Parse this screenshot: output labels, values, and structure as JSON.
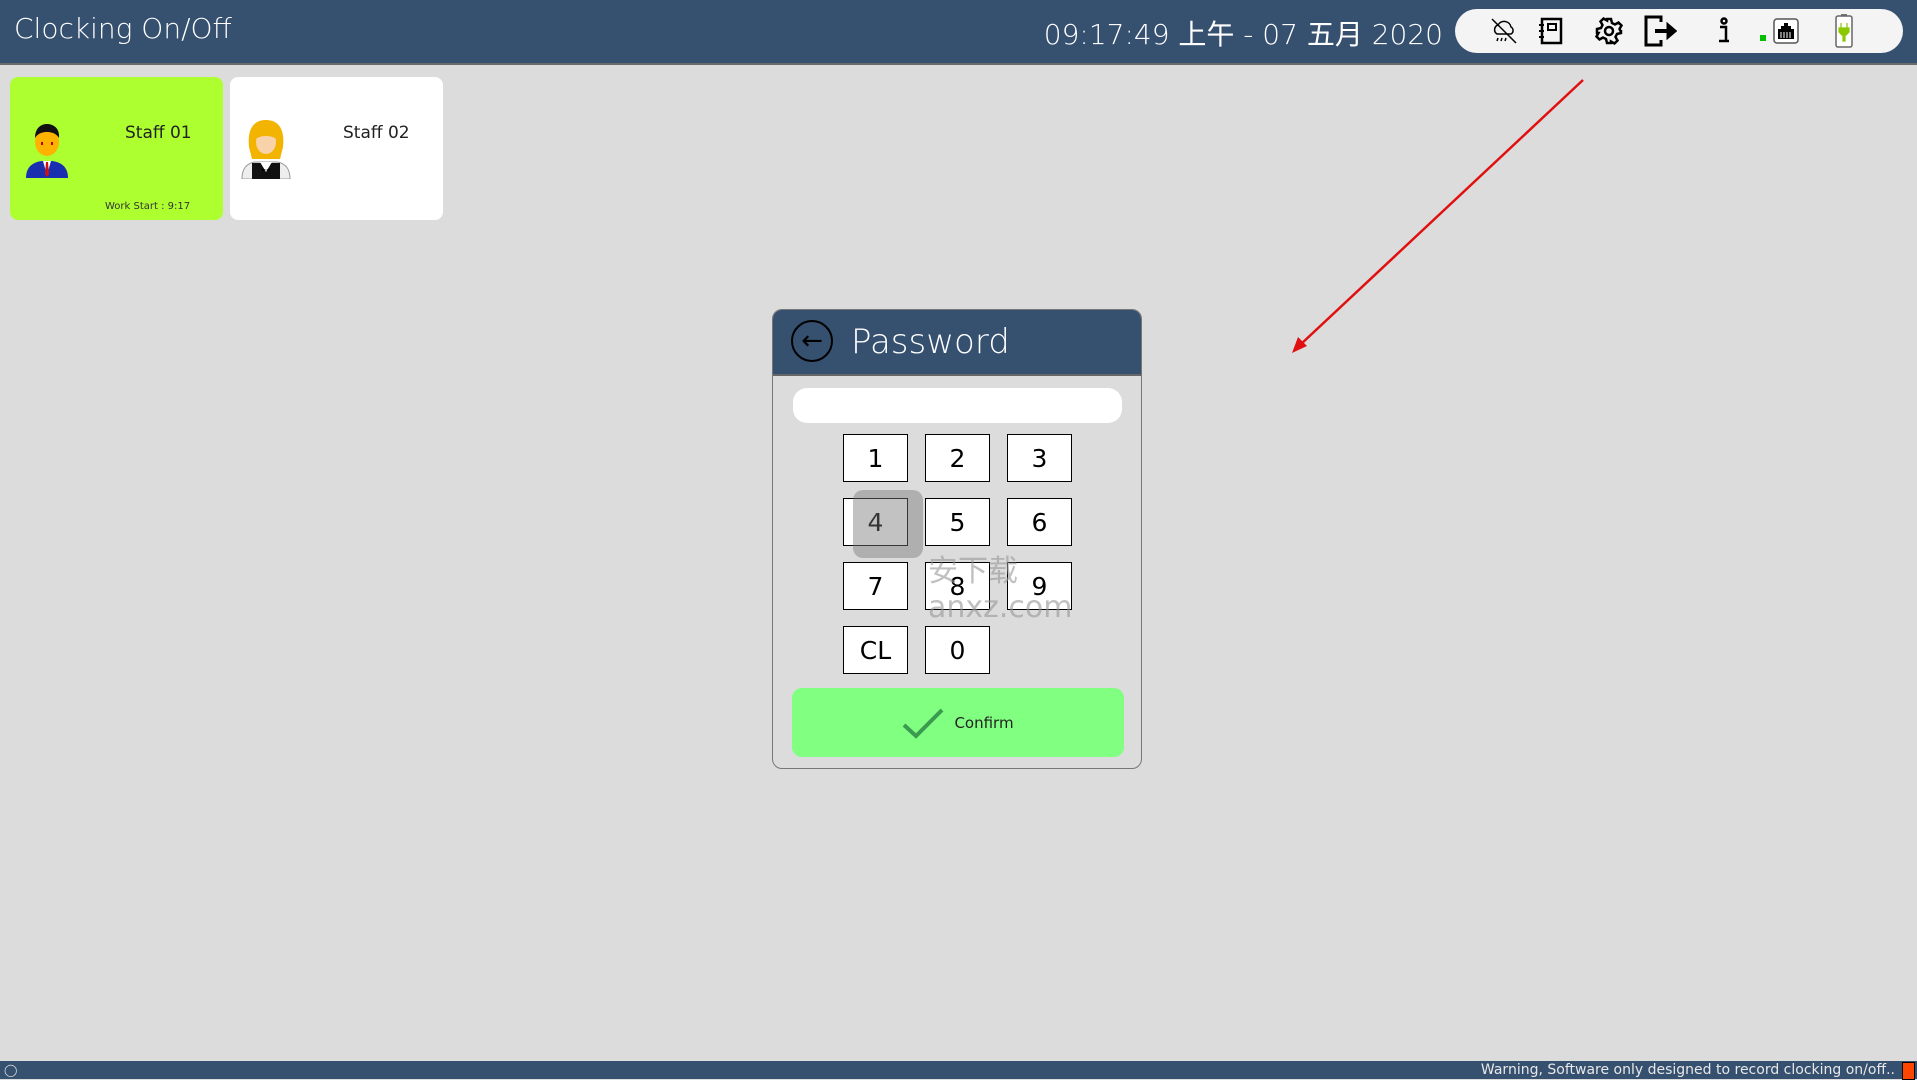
{
  "header": {
    "title": "Clocking On/Off",
    "datetime": "09:17:49 上午 - 07 五月 2020"
  },
  "toolbar_icons": [
    "cloud-off-icon",
    "notebook-icon",
    "gear-icon",
    "exit-icon",
    "info-icon",
    "network-icon",
    "battery-charging-icon"
  ],
  "network_status_color": "#00c000",
  "staff": [
    {
      "name": "Staff 01",
      "work_start": "Work Start : 9:17",
      "color": "#adff2f",
      "active": true
    },
    {
      "name": "Staff 02",
      "color": "#ffffff",
      "active": false
    }
  ],
  "dialog": {
    "title": "Password",
    "password_value": "",
    "keys": [
      "1",
      "2",
      "3",
      "4",
      "5",
      "6",
      "7",
      "8",
      "9",
      "CL",
      "0"
    ],
    "confirm_label": "Confirm",
    "confirm_color": "#80ff80"
  },
  "watermark": "安下载 anxz.com",
  "status_bar": {
    "warning": "Warning, Software only designed to record clocking on/off..",
    "indicator_color": "#ff4500"
  }
}
